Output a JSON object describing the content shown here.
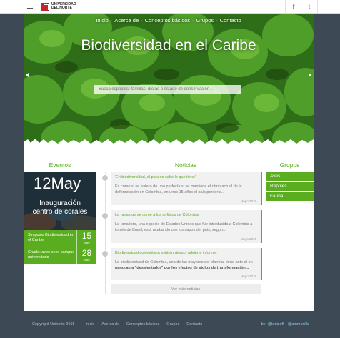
{
  "header": {
    "logo_text_1": "UNIVERSIDAD",
    "logo_text_2": "DEL NORTE",
    "facebook_glyph": "f",
    "twitter_glyph": "t"
  },
  "nav": {
    "items": [
      "Inicio",
      "Acerca de",
      "Conceptos básicos",
      "Grupos",
      "Contacto"
    ],
    "separator": "·"
  },
  "hero": {
    "title": "Biodiversidad en el Caribe",
    "search_placeholder": "Busca especies, familias, dietas o estado de conservación..."
  },
  "sections": {
    "events": "Eventos",
    "news": "Noticias",
    "groups": "Grupos"
  },
  "events": {
    "featured_day": "12",
    "featured_month": "May",
    "featured_title_1": "Inauguración",
    "featured_title_2": "centro de corales",
    "items": [
      {
        "title": "Simposio Biodiversidad en el Caribe",
        "day": "15",
        "month": "May"
      },
      {
        "title": "Charla: aves en el campus universitario",
        "day": "28",
        "month": "May"
      }
    ]
  },
  "news": {
    "items": [
      {
        "headline": "'En biodiversidad, el país no sabe lo que tiene'",
        "body": "Es como si se tratara de una profecía si se mantiene el ritmo actual de la deforestación en Colombia, en unos 15 años el país perdería...",
        "date": "Mayo 2015"
      },
      {
        "headline": "La rana que se come a los anfibios de Colombia",
        "body": "La rana toro, una especie de Estados Unidos que fue introducida a Colombia a través de Brasil, está acabando con los sapos del país, segun...",
        "date": "Mayo 2015"
      },
      {
        "headline": "Biodiversidad colombiana está en riesgo, advierte informe.",
        "body_1": "La biodiversidad de Colombia, una de las mayores del planeta, tiene ante sí un ",
        "body_bold": "panorama \"desalentador\" por los efectos de siglos de transformación...",
        "date": "Mayo 2015"
      }
    ],
    "more": "Ver más noticias"
  },
  "groups": [
    "Aves",
    "Reptiles",
    "Fauna"
  ],
  "footer": {
    "copyright": "Copyright Uninorte 2015",
    "links": [
      "Inicio",
      "Acerca de",
      "Conceptos básicos",
      "Grupos",
      "Contacto"
    ],
    "by_label": "by:",
    "by_1": "@tunizoft",
    "by_sep": " - ",
    "by_2": "@ammocilla"
  },
  "colors": {
    "accent": "#5aad1f",
    "footer_bg": "#3d4a55"
  }
}
